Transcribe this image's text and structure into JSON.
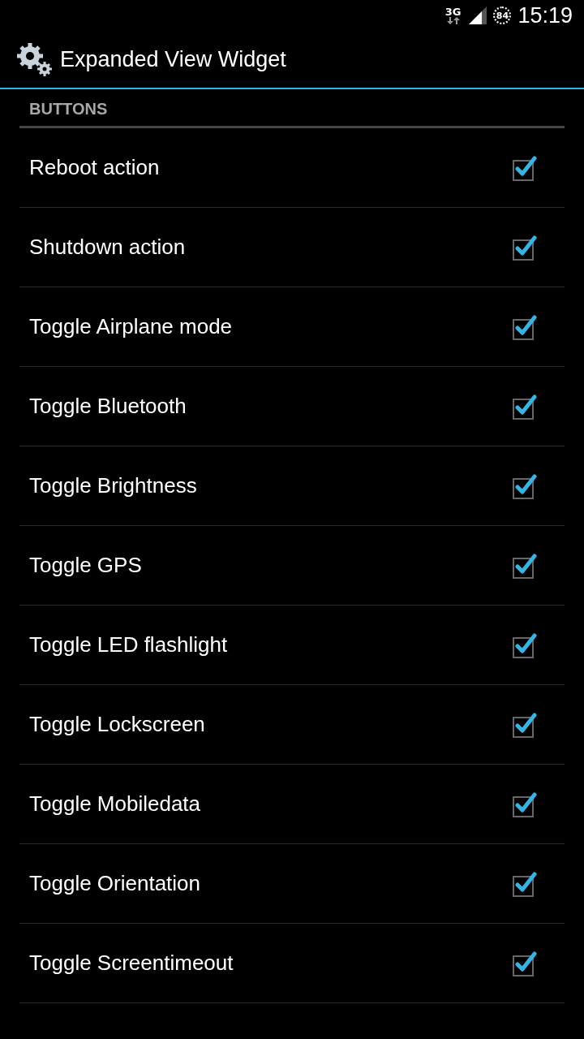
{
  "status_bar": {
    "network": "3G",
    "battery": "84",
    "time": "15:19"
  },
  "action_bar": {
    "title": "Expanded View Widget"
  },
  "section": {
    "title": "BUTTONS"
  },
  "items": [
    {
      "label": "Reboot action",
      "checked": true
    },
    {
      "label": "Shutdown action",
      "checked": true
    },
    {
      "label": "Toggle Airplane mode",
      "checked": true
    },
    {
      "label": "Toggle Bluetooth",
      "checked": true
    },
    {
      "label": "Toggle Brightness",
      "checked": true
    },
    {
      "label": "Toggle GPS",
      "checked": true
    },
    {
      "label": "Toggle LED flashlight",
      "checked": true
    },
    {
      "label": "Toggle Lockscreen",
      "checked": true
    },
    {
      "label": "Toggle Mobiledata",
      "checked": true
    },
    {
      "label": "Toggle Orientation",
      "checked": true
    },
    {
      "label": "Toggle Screentimeout",
      "checked": true
    }
  ]
}
